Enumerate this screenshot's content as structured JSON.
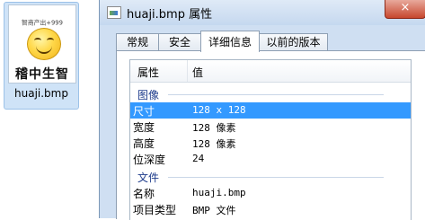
{
  "desktop_file": {
    "thumbnail_header": "智商产出+999",
    "thumbnail_caption": "稽中生智",
    "name": "huaji.bmp"
  },
  "dialog": {
    "title": "huaji.bmp 属性",
    "close_glyph": "×",
    "tabs": [
      "常规",
      "安全",
      "详细信息",
      "以前的版本"
    ],
    "active_tab": "详细信息",
    "columns": {
      "property": "属性",
      "value": "值"
    },
    "groups": {
      "image": "图像",
      "file": "文件"
    },
    "image_rows": [
      {
        "key": "尺寸",
        "value": "128 x 128"
      },
      {
        "key": "宽度",
        "value": "128 像素"
      },
      {
        "key": "高度",
        "value": "128 像素"
      },
      {
        "key": "位深度",
        "value": "24"
      }
    ],
    "file_rows": [
      {
        "key": "名称",
        "value": "huaji.bmp"
      },
      {
        "key": "项目类型",
        "value": "BMP 文件"
      }
    ],
    "selected_row": "尺寸"
  }
}
